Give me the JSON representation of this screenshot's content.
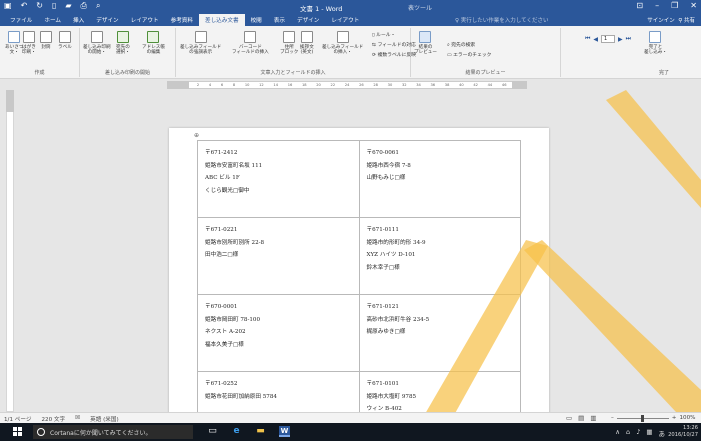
{
  "titlebar": {
    "doc_title": "文書 1 - Word",
    "context_title": "表ツール",
    "qat_icons": [
      "save-icon",
      "undo-icon",
      "redo-icon",
      "new-doc-icon",
      "open-icon",
      "print-icon",
      "preview-icon"
    ],
    "window_controls": [
      "ribbon-display-icon",
      "minimize-icon",
      "restore-icon",
      "close-icon"
    ]
  },
  "tabs": [
    "ファイル",
    "ホーム",
    "挿入",
    "デザイン",
    "レイアウト",
    "参考資料",
    "差し込み文書",
    "校閲",
    "表示",
    "デザイン",
    "レイアウト"
  ],
  "active_tab": "差し込み文書",
  "tellme": "実行したい作業を入力してください",
  "signin": "サインイン",
  "share": "共有",
  "ribbon": {
    "groups": {
      "create": "作成",
      "start_merge": "差し込み印刷の開始",
      "write_insert": "文章入力とフィールドの挿入",
      "preview": "結果のプレビュー",
      "finish": "完了"
    },
    "buttons": {
      "envelopes": "あいさつ\n文・",
      "postcard": "はがき\n印刷・",
      "envelope": "封筒",
      "labels": "ラベル",
      "start_mail_merge": "差し込み印刷\nの開始・",
      "select_recipients": "宛先の\n選択・",
      "edit_list": "アドレス帳\nの編集",
      "highlight_fields": "差し込みフィールド\nの強調表示",
      "barcode": "バーコード\nフィールドの挿入",
      "address_block": "住所\nブロック",
      "greeting_line": "挨拶文\n(英文)",
      "insert_field": "差し込みフィールド\nの挿入・",
      "rules": "ルール・",
      "match_fields": "フィールドの対応",
      "update_labels": "複数ラベルに反映",
      "preview_results": "結果の\nプレビュー",
      "find_recipient": "宛先の検索",
      "check_errors": "エラーのチェック",
      "finish_merge": "完了と\n差し込み・"
    },
    "record_number": "1"
  },
  "ruler_ticks": [
    "4",
    "2",
    "2",
    "4",
    "6",
    "8",
    "10",
    "12",
    "14",
    "16",
    "18",
    "20",
    "22",
    "24",
    "26",
    "28",
    "30",
    "32",
    "34",
    "36",
    "38",
    "40",
    "42",
    "44",
    "46",
    "48"
  ],
  "labels": [
    [
      "〒671-2412",
      "姫路市安富町名坂 111",
      "ABC ビル 1F",
      "くじら観光□御中"
    ],
    [
      "〒670-0061",
      "姫路市西今宿 7-8",
      "山野もみじ□様"
    ],
    [
      "〒671-0221",
      "姫路市別所町別所 22-8",
      "田中浩二□様"
    ],
    [
      "〒671-0111",
      "姫路市的形町的形 34-9",
      "XYZ ハイツ D-101",
      "鈴木幸子□様"
    ],
    [
      "〒670-0001",
      "姫路市岡田町 78-100",
      "ネクスト A-202",
      "福本久美子□様"
    ],
    [
      "〒671-0121",
      "高砂市北浜町牛谷 234-5",
      "梶原みゆき□様"
    ],
    [
      "〒671-0252",
      "姫路市花田町加納原田 5784"
    ],
    [
      "〒671-0101",
      "姫路市大塩町 9785",
      "ウィン B-402"
    ]
  ],
  "status": {
    "page": "1/1 ページ",
    "words": "220 文字",
    "lang": "英語 (米国)",
    "zoom": "100%",
    "zoom_level": 1.0
  },
  "taskbar": {
    "cortana": "Cortanaに何か聞いてみてください。",
    "time": "13:26",
    "date": "2016/10/27",
    "ime": "あ"
  },
  "watermark_color": "#f7c04a"
}
